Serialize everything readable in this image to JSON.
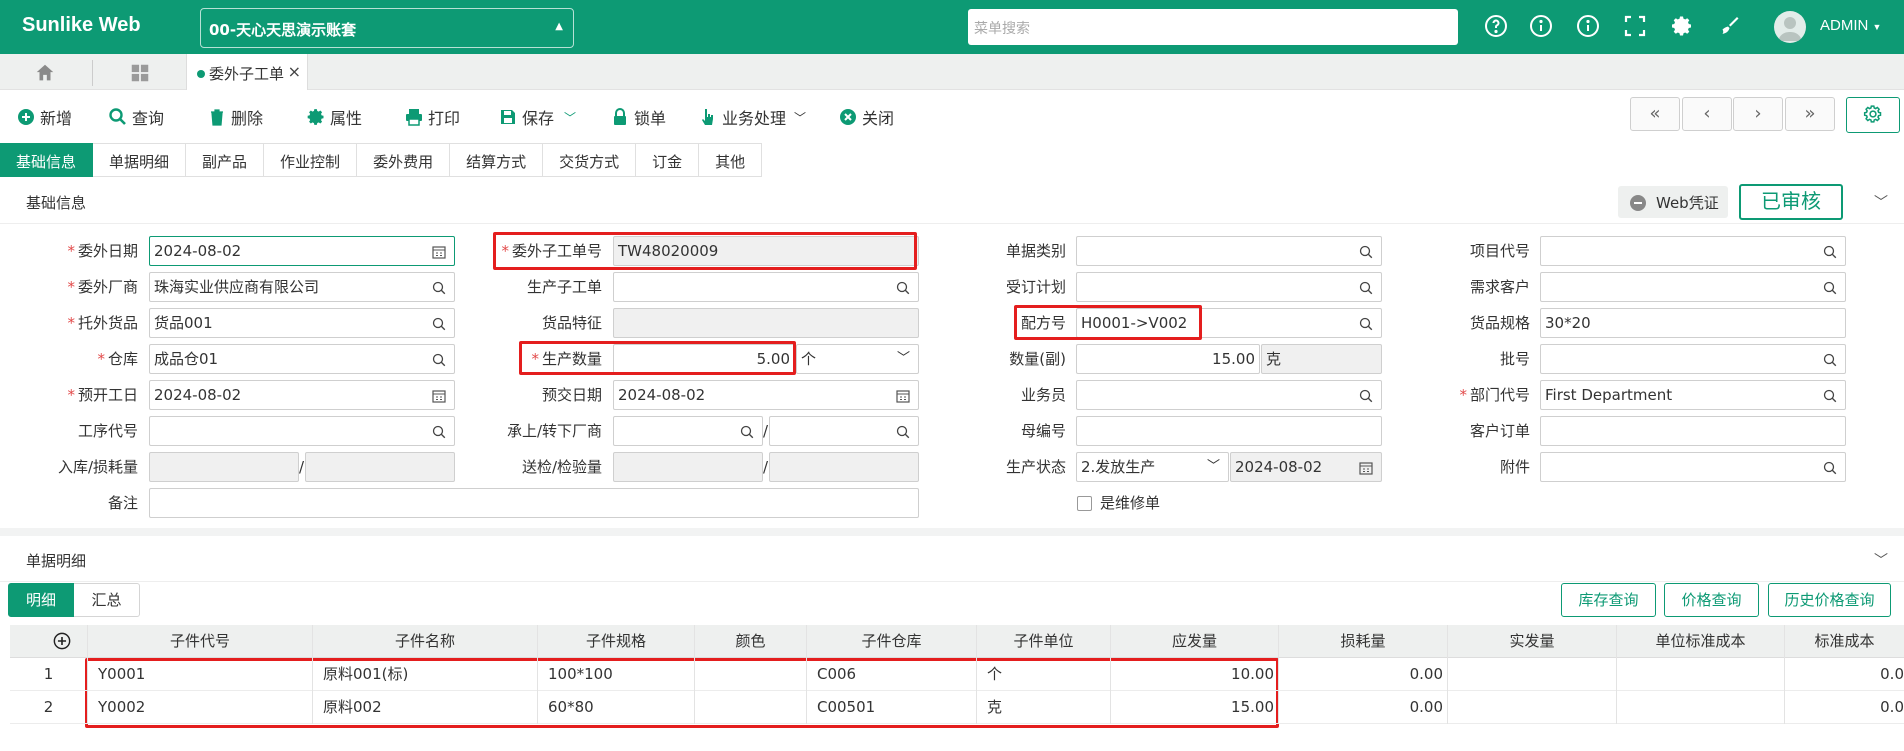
{
  "app": {
    "brand": "Sunlike Web",
    "account": "00-天心天思演示账套",
    "search_placeholder": "菜单搜索",
    "user": "ADMIN"
  },
  "tabs": {
    "page_tab": "委外子工单"
  },
  "toolbar": {
    "add": "新增",
    "query": "查询",
    "delete": "删除",
    "properties": "属性",
    "print": "打印",
    "save": "保存",
    "lock": "锁单",
    "business": "业务处理",
    "close": "关闭"
  },
  "subtabs": [
    "基础信息",
    "单据明细",
    "副产品",
    "作业控制",
    "委外费用",
    "结算方式",
    "交货方式",
    "订金",
    "其他"
  ],
  "basic_section": {
    "title": "基础信息",
    "web_voucher": "Web凭证",
    "status": "已审核"
  },
  "form": {
    "outsource_date_label": "委外日期",
    "outsource_date": "2024-08-02",
    "vendor_label": "委外厂商",
    "vendor": "珠海实业供应商有限公司",
    "goods_label": "托外货品",
    "goods": "货品001",
    "warehouse_label": "仓库",
    "warehouse": "成品仓01",
    "start_date_label": "预开工日",
    "start_date": "2024-08-02",
    "process_code_label": "工序代号",
    "process_code": "",
    "inbound_label": "入库/损耗量",
    "remark_label": "备注",
    "order_no_label": "委外子工单号",
    "order_no": "TW48020009",
    "prod_suborder_label": "生产子工单",
    "goods_feature_label": "货品特征",
    "prod_qty_label": "生产数量",
    "prod_qty": "5.00",
    "prod_unit": "个",
    "due_date_label": "预交日期",
    "due_date": "2024-08-02",
    "transfer_vendor_label": "承上/转下厂商",
    "inspect_label": "送检/检验量",
    "doc_type_label": "单据类别",
    "order_plan_label": "受订计划",
    "formula_label": "配方号",
    "formula": "H0001->V002",
    "qty_sub_label": "数量(副)",
    "qty_sub": "15.00",
    "qty_sub_unit": "克",
    "salesman_label": "业务员",
    "parent_no_label": "母编号",
    "prod_status_label": "生产状态",
    "prod_status": "2.发放生产",
    "prod_status_date": "2024-08-02",
    "is_repair_label": "是维修单",
    "project_label": "项目代号",
    "demand_customer_label": "需求客户",
    "goods_spec_label": "货品规格",
    "goods_spec": "30*20",
    "batch_label": "批号",
    "dept_label": "部门代号",
    "dept": "First Department",
    "customer_order_label": "客户订单",
    "attachment_label": "附件"
  },
  "detail_section": {
    "title": "单据明细",
    "tab_detail": "明细",
    "tab_summary": "汇总",
    "btn_stock": "库存查询",
    "btn_price": "价格查询",
    "btn_history": "历史价格查询"
  },
  "table": {
    "columns": [
      "子件代号",
      "子件名称",
      "子件规格",
      "颜色",
      "子件仓库",
      "子件单位",
      "应发量",
      "损耗量",
      "实发量",
      "单位标准成本",
      "标准成本"
    ],
    "rows": [
      {
        "n": "1",
        "code": "Y0001",
        "name": "原料001(标)",
        "spec": "100*100",
        "color": "",
        "wh": "C006",
        "unit": "个",
        "qty": "10.00",
        "loss": "0.00",
        "actual": "",
        "unit_cost": "",
        "cost": "0.0"
      },
      {
        "n": "2",
        "code": "Y0002",
        "name": "原料002",
        "spec": "60*80",
        "color": "",
        "wh": "C00501",
        "unit": "克",
        "qty": "15.00",
        "loss": "0.00",
        "actual": "",
        "unit_cost": "",
        "cost": "0.0"
      }
    ]
  },
  "colors": {
    "brand": "#0d9a74",
    "highlight": "#e41e1e",
    "required": "#e24b4b"
  }
}
